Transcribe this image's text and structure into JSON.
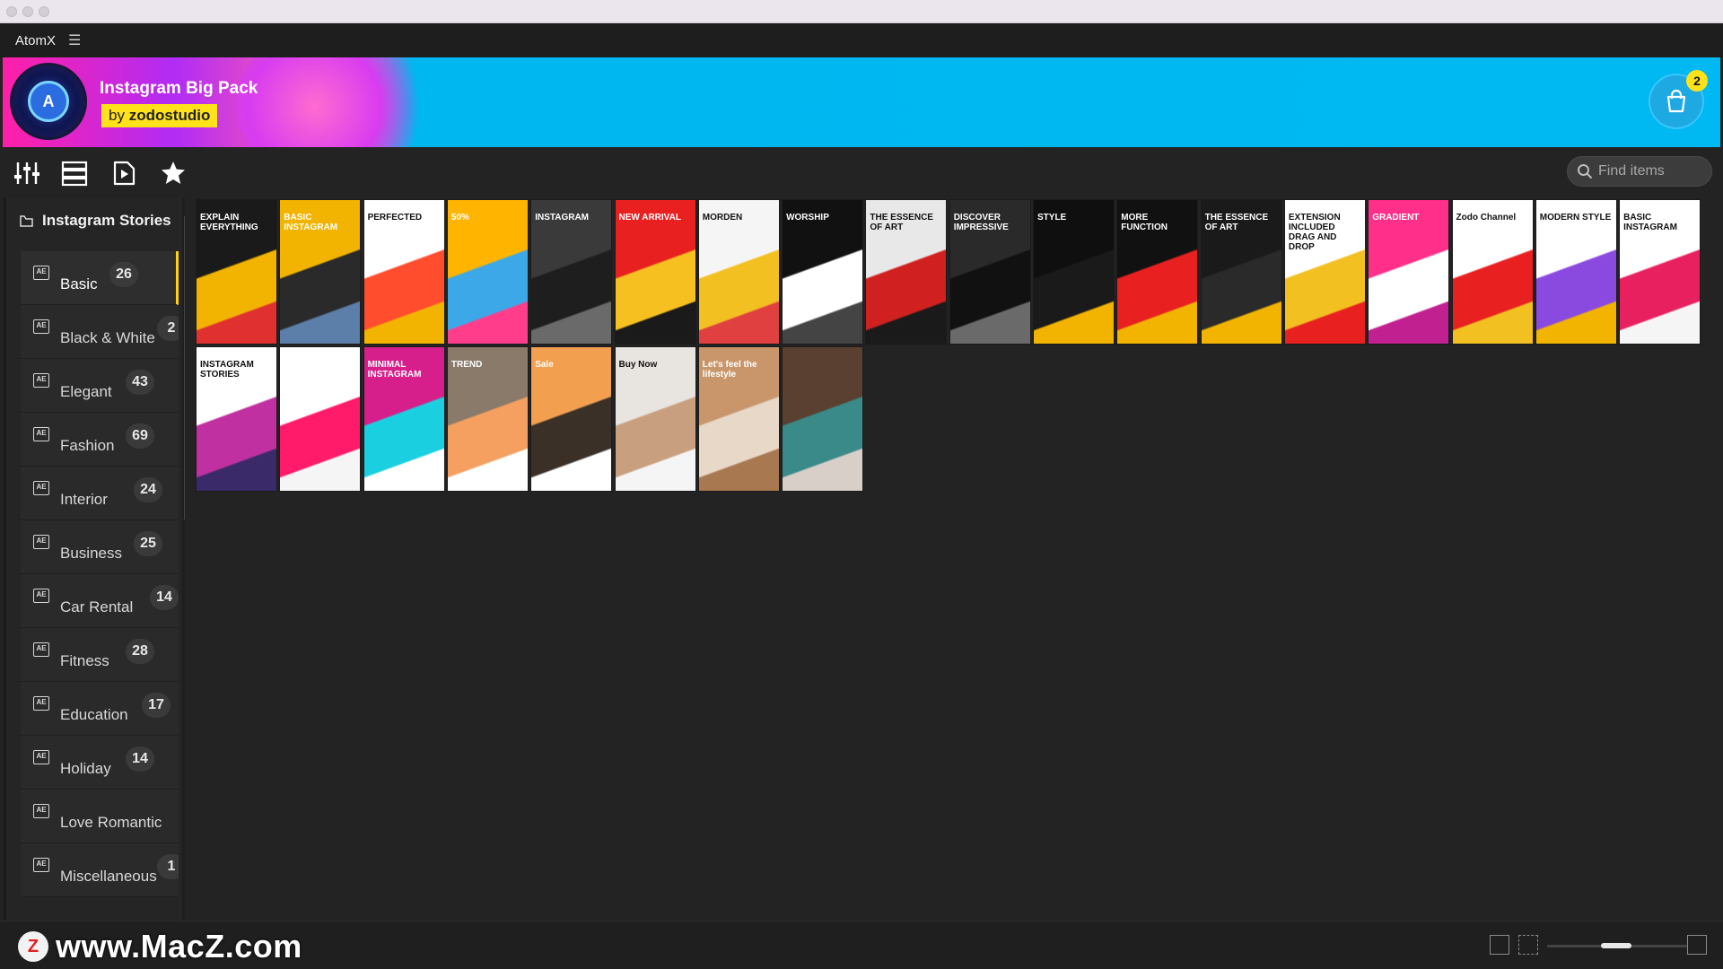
{
  "app": {
    "name": "AtomX"
  },
  "banner": {
    "title": "Instagram Big Pack",
    "author_prefix": "by",
    "author": "zodostudio",
    "logo_letter": "A",
    "cart_count": "2"
  },
  "toolbar": {
    "icons": [
      "sliders-icon",
      "list-view-icon",
      "preview-icon",
      "favorites-star-icon"
    ]
  },
  "search": {
    "placeholder": "Find items"
  },
  "sidebar": {
    "header": "Instagram Stories",
    "items": [
      {
        "label": "Basic",
        "count": "26",
        "active": true
      },
      {
        "label": "Black & White",
        "count": "2"
      },
      {
        "label": "Elegant",
        "count": "43"
      },
      {
        "label": "Fashion",
        "count": "69"
      },
      {
        "label": "Interior",
        "count": "24"
      },
      {
        "label": "Business",
        "count": "25"
      },
      {
        "label": "Car Rental",
        "count": "14"
      },
      {
        "label": "Fitness",
        "count": "28"
      },
      {
        "label": "Education",
        "count": "17"
      },
      {
        "label": "Holiday",
        "count": "14"
      },
      {
        "label": "Love Romantic",
        "count": ""
      },
      {
        "label": "Miscellaneous",
        "count": "1"
      }
    ]
  },
  "grid": {
    "thumbs": [
      {
        "text": "EXPLAIN EVERYTHING",
        "colors": [
          "#1a1a1a",
          "#f2b400",
          "#e03030"
        ]
      },
      {
        "text": "BASIC INSTAGRAM",
        "colors": [
          "#f2b400",
          "#2a2a2a",
          "#5b7fa8"
        ]
      },
      {
        "text": "PERFECTED",
        "colors": [
          "#ffffff",
          "#ff4d2e",
          "#f2b400"
        ]
      },
      {
        "text": "50%",
        "colors": [
          "#ffb400",
          "#3da8e8",
          "#ff3d8a"
        ]
      },
      {
        "text": "INSTAGRAM",
        "colors": [
          "#3a3a3a",
          "#1e1e1e",
          "#6a6a6a"
        ]
      },
      {
        "text": "NEW ARRIVAL",
        "colors": [
          "#e82020",
          "#f6c020",
          "#1a1a1a"
        ]
      },
      {
        "text": "MORDEN",
        "colors": [
          "#f5f5f5",
          "#f2c020",
          "#e04040"
        ]
      },
      {
        "text": "WORSHIP",
        "colors": [
          "#111111",
          "#ffffff",
          "#444444"
        ]
      },
      {
        "text": "THE ESSENCE OF ART",
        "colors": [
          "#e8e8e8",
          "#d02020",
          "#1a1a1a"
        ]
      },
      {
        "text": "DISCOVER IMPRESSIVE",
        "colors": [
          "#2a2a2a",
          "#111111",
          "#6a6a6a"
        ]
      },
      {
        "text": "STYLE",
        "colors": [
          "#0f0f0f",
          "#1a1a1a",
          "#f2b400"
        ]
      },
      {
        "text": "MORE FUNCTION",
        "colors": [
          "#111111",
          "#e82020",
          "#f2b400"
        ]
      },
      {
        "text": "THE ESSENCE OF ART",
        "colors": [
          "#1a1a1a",
          "#2a2a2a",
          "#f2b400"
        ]
      },
      {
        "text": "EXTENSION INCLUDED DRAG AND DROP",
        "colors": [
          "#ffffff",
          "#f2c020",
          "#e82020"
        ]
      },
      {
        "text": "GRADIENT",
        "colors": [
          "#ff2f8a",
          "#ffffff",
          "#c02090"
        ]
      },
      {
        "text": "Zodo Channel",
        "colors": [
          "#ffffff",
          "#e82020",
          "#f2c020"
        ]
      },
      {
        "text": "MODERN STYLE",
        "colors": [
          "#ffffff",
          "#8a4ae0",
          "#f2b400"
        ]
      },
      {
        "text": "BASIC INSTAGRAM",
        "colors": [
          "#ffffff",
          "#e82060",
          "#f5f5f5"
        ]
      },
      {
        "text": "INSTAGRAM STORIES",
        "colors": [
          "#ffffff",
          "#c030a0",
          "#3a2a6a"
        ]
      },
      {
        "text": "",
        "colors": [
          "#ffffff",
          "#ff1a6a",
          "#f5f5f5"
        ]
      },
      {
        "text": "MINIMAL INSTAGRAM",
        "colors": [
          "#d61f8a",
          "#1ad0e0",
          "#ffffff"
        ]
      },
      {
        "text": "TREND",
        "colors": [
          "#8a7a6a",
          "#f5a060",
          "#ffffff"
        ]
      },
      {
        "text": "Sale",
        "colors": [
          "#f2a050",
          "#3a3028",
          "#ffffff"
        ]
      },
      {
        "text": "Buy Now",
        "colors": [
          "#e8e4e0",
          "#c8a080",
          "#f5f5f5"
        ]
      },
      {
        "text": "Let's feel the lifestyle",
        "colors": [
          "#c8966a",
          "#e8d8c8",
          "#a87850"
        ]
      },
      {
        "text": "",
        "colors": [
          "#5a4030",
          "#3a8a8a",
          "#d8d0c8"
        ]
      }
    ]
  }
}
